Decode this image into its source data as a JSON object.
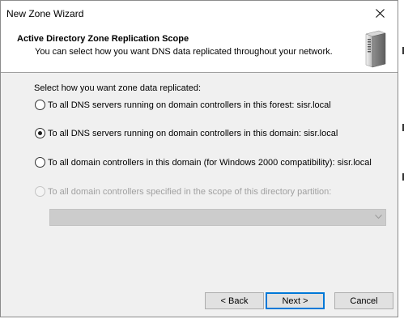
{
  "window": {
    "title": "New Zone Wizard",
    "close_icon": "close-icon"
  },
  "header": {
    "title": "Active Directory Zone Replication Scope",
    "subtitle": "You can select how you want DNS data replicated throughout your network.",
    "icon": "server-icon"
  },
  "content": {
    "prompt": "Select how you want zone data replicated:",
    "options": [
      {
        "label": "To all DNS servers running on domain controllers in this forest: sisr.local",
        "selected": false,
        "enabled": true
      },
      {
        "label": "To all DNS servers running on domain controllers in this domain: sisr.local",
        "selected": true,
        "enabled": true
      },
      {
        "label": "To all domain controllers in this domain (for Windows 2000 compatibility): sisr.local",
        "selected": false,
        "enabled": true
      },
      {
        "label": "To all domain controllers specified in the scope of this directory partition:",
        "selected": false,
        "enabled": false
      }
    ],
    "partition_dropdown": {
      "value": "",
      "enabled": false
    }
  },
  "buttons": {
    "back": "< Back",
    "next": "Next >",
    "cancel": "Cancel"
  },
  "colors": {
    "accent": "#0078d7",
    "disabled_text": "#a0a0a0",
    "panel_bg": "#f0f0f0"
  }
}
